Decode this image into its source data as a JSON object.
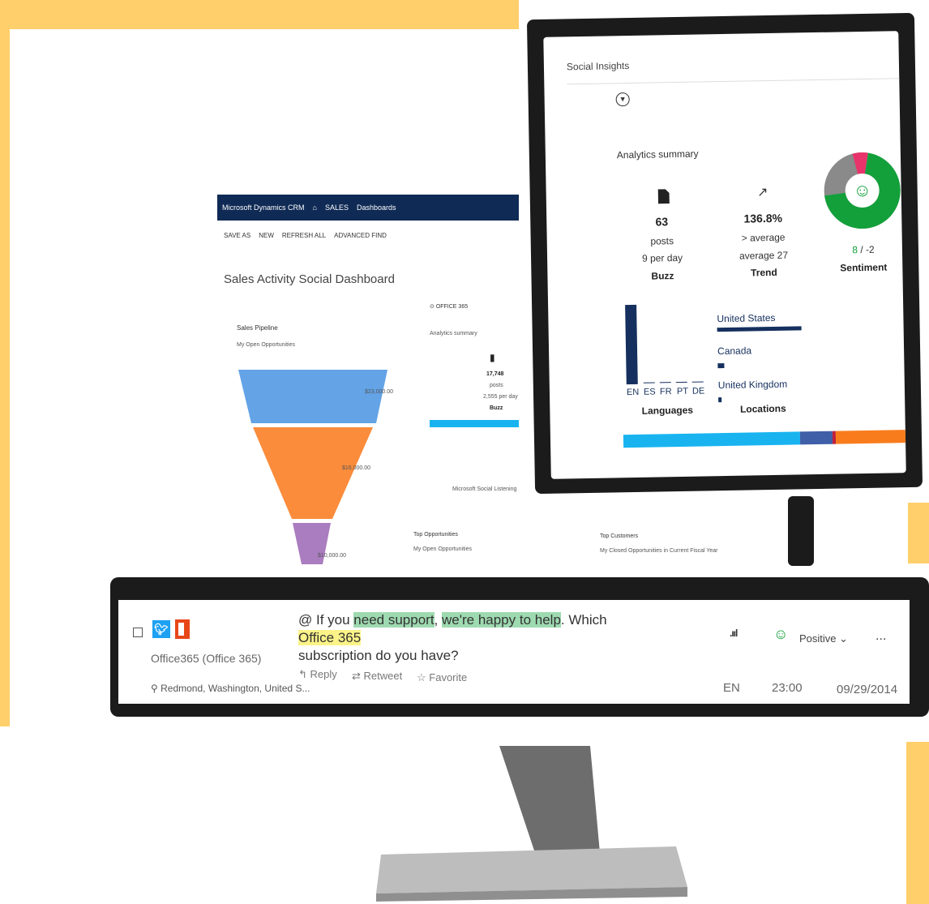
{
  "crm": {
    "app": "Microsoft Dynamics CRM",
    "nav_sales": "SALES",
    "nav_dashboards": "Dashboards",
    "cmd": [
      "SAVE AS",
      "NEW",
      "REFRESH ALL",
      "ADVANCED FIND"
    ],
    "dashboard_title": "Sales Activity Social Dashboard",
    "pipeline_title": "Sales Pipeline",
    "pipeline_sub": "My Open Opportunities",
    "funnel_values": [
      "$23,000.00",
      "$16,000.00",
      "$10,000.00"
    ],
    "social_filter": "OFFICE 365",
    "analytics_summary": "Analytics summary",
    "buzz_count": "17,748",
    "buzz_posts": "posts",
    "buzz_per_day": "2,555 per day",
    "buzz_label": "Buzz",
    "footer": "Microsoft Social Listening",
    "top_opportunities": "Top Opportunities",
    "top_opportunities_sub": "My Open Opportunities",
    "top_customers": "Top Customers",
    "top_customers_sub": "My Closed Opportunities in Current Fiscal Year"
  },
  "insights": {
    "title": "Social Insights",
    "summary": "Analytics summary",
    "buzz": {
      "count": "63",
      "unit": "posts",
      "rate": "9 per day",
      "label": "Buzz"
    },
    "trend": {
      "value": "136.8%",
      "desc": "> average",
      "avg": "average 27",
      "label": "Trend"
    },
    "sentiment": {
      "pos": "8",
      "sep": " / ",
      "neg": "-2",
      "label": "Sentiment"
    },
    "languages": {
      "codes": [
        "EN",
        "ES",
        "FR",
        "PT",
        "DE"
      ],
      "label": "Languages"
    },
    "locations": {
      "names": [
        "United States",
        "Canada",
        "United Kingdom"
      ],
      "label": "Locations"
    },
    "colors": {
      "navy": "#15305e",
      "green": "#13a03a",
      "pink": "#e8336a",
      "grey": "#8a8a8a",
      "blue": "#19b4f0",
      "orange": "#f97c1c"
    }
  },
  "tweet": {
    "author": "Office365 (Office 365)",
    "location": "Redmond, Washington, United S...",
    "text_1": "@ If you ",
    "hl_1": "need support",
    "text_2": ", ",
    "hl_2": "we're happy to help",
    "text_3": ". Which ",
    "hl_3": "Office 365",
    "text_4": "subscription do you have?",
    "reply": "Reply",
    "retweet": "Retweet",
    "favorite": "Favorite",
    "sentiment": "Positive",
    "more": "...",
    "lang": "EN",
    "time": "23:00",
    "date": "09/29/2014"
  },
  "icons": [
    "twitter-icon",
    "office-icon",
    "location-pin-icon",
    "reply-icon",
    "retweet-icon",
    "star-icon",
    "signal-icon",
    "smiley-icon",
    "chevron-down-icon",
    "document-icon",
    "trend-arrow-icon",
    "filter-icon"
  ]
}
